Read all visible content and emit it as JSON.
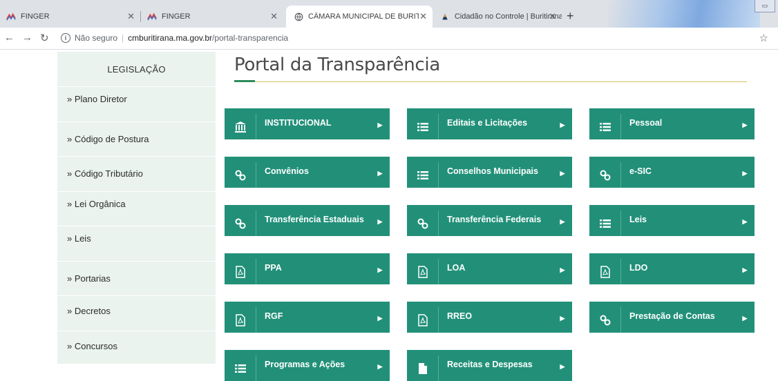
{
  "browser": {
    "tabs": [
      {
        "title": "FINGER",
        "icon": "finger-logo-icon",
        "active": false
      },
      {
        "title": "FINGER",
        "icon": "finger-logo-icon",
        "active": false
      },
      {
        "title": "CÂMARA MUNICIPAL DE BURITIR",
        "icon": "globe-icon",
        "active": true
      },
      {
        "title": "Cidadão no Controle | Buritirana",
        "icon": "site-favicon",
        "active": false
      }
    ],
    "new_tab": "+",
    "address": {
      "security": "Não seguro",
      "host": "cmburitirana.ma.gov.br",
      "path": "/portal-transparencia"
    }
  },
  "sidebar": {
    "header": "LEGISLAÇÃO",
    "items": [
      {
        "label": "» Plano Diretor"
      },
      {
        "label": "» Código de Postura"
      },
      {
        "label": "» Código Tributário"
      },
      {
        "label": "» Lei Orgânica"
      },
      {
        "label": "» Leis"
      },
      {
        "label": "» Portarias"
      },
      {
        "label": "» Decretos"
      },
      {
        "label": "» Concursos"
      }
    ]
  },
  "main": {
    "title": "Portal da Transparência",
    "accent_color": "#229079",
    "buttons": [
      {
        "label": "INSTITUCIONAL",
        "icon": "bank-icon"
      },
      {
        "label": "Editais e Licitações",
        "icon": "list-icon"
      },
      {
        "label": "Pessoal",
        "icon": "list-icon"
      },
      {
        "label": "Convênios",
        "icon": "link-icon"
      },
      {
        "label": "Conselhos Municipais",
        "icon": "list-icon"
      },
      {
        "label": "e-SIC",
        "icon": "link-icon"
      },
      {
        "label": "Transferência Estaduais",
        "icon": "link-icon"
      },
      {
        "label": "Transferência Federais",
        "icon": "link-icon"
      },
      {
        "label": "Leis",
        "icon": "list-icon"
      },
      {
        "label": "PPA",
        "icon": "pdf-icon"
      },
      {
        "label": "LOA",
        "icon": "pdf-icon"
      },
      {
        "label": "LDO",
        "icon": "pdf-icon"
      },
      {
        "label": "RGF",
        "icon": "pdf-icon"
      },
      {
        "label": "RREO",
        "icon": "pdf-icon"
      },
      {
        "label": "Prestação de Contas",
        "icon": "link-icon"
      },
      {
        "label": "Programas e Ações",
        "icon": "list-icon"
      },
      {
        "label": "Receitas e Despesas",
        "icon": "file-icon"
      }
    ]
  }
}
